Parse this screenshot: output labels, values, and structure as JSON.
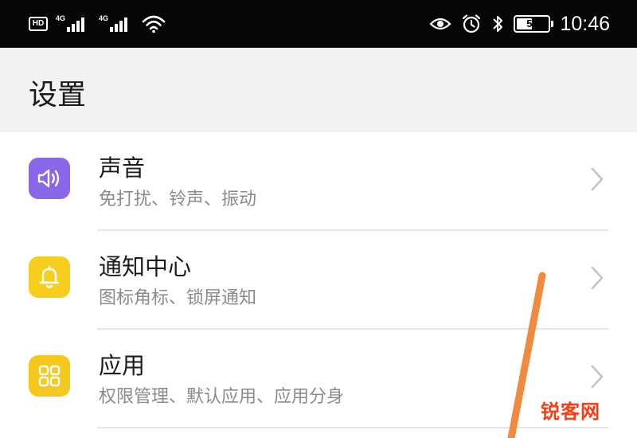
{
  "status_bar": {
    "hd_label": "HD",
    "sim1_network": "4G",
    "sim2_network": "4G",
    "battery_level": "54",
    "battery_fraction": 0.54,
    "time": "10:46",
    "icons": [
      "hd-icon",
      "signal-icon",
      "signal-icon",
      "wifi-icon",
      "eye-icon",
      "alarm-icon",
      "bluetooth-icon",
      "battery-icon"
    ]
  },
  "header": {
    "title": "设置"
  },
  "settings": {
    "items": [
      {
        "title": "声音",
        "subtitle": "免打扰、铃声、振动",
        "icon": "speaker-icon",
        "color": "#8a67e8"
      },
      {
        "title": "通知中心",
        "subtitle": "图标角标、锁屏通知",
        "icon": "bell-icon",
        "color": "#f7cd1e"
      },
      {
        "title": "应用",
        "subtitle": "权限管理、默认应用、应用分身",
        "icon": "apps-grid-icon",
        "color": "#f4c81c"
      }
    ]
  },
  "watermark": {
    "text": "锐客网",
    "color": "#ff3b10"
  },
  "colors": {
    "accent_stroke": "#ef8a3e",
    "chevron": "#c4c4c4"
  }
}
